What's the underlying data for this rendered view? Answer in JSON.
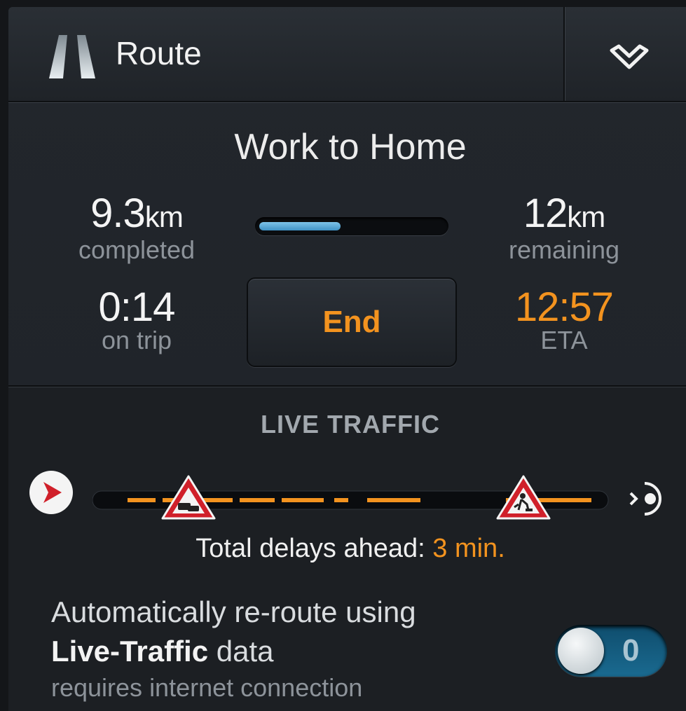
{
  "header": {
    "title": "Route",
    "route_icon": "road-icon",
    "collapse_icon": "chevron-down-icon"
  },
  "trip": {
    "name": "Work to Home",
    "completed": {
      "value": "9.3",
      "unit": "km",
      "label": "completed"
    },
    "remaining": {
      "value": "12",
      "unit": "km",
      "label": "remaining"
    },
    "on_trip": {
      "value": "0:14",
      "label": "on trip"
    },
    "eta": {
      "value": "12:57",
      "label": "ETA"
    },
    "progress_fraction": 0.44,
    "end_label": "End"
  },
  "traffic": {
    "title": "LIVE TRAFFIC",
    "start_icon": "start-arrow-icon",
    "destination_icon": "destination-icon",
    "incident_icons": [
      "traffic-jam-warning-icon",
      "roadworks-warning-icon"
    ],
    "delays_label": "Total delays ahead:",
    "delays_value": "3 min."
  },
  "reroute": {
    "line1": "Automatically re-route using",
    "bold": "Live-Traffic",
    "line2_rest": "data",
    "sub": "requires internet connection",
    "toggle_state": "0"
  },
  "colors": {
    "accent": "#f3931f",
    "progress": "#5aaad6",
    "toggle": "#1a6a90",
    "incident": "#d0202a"
  }
}
